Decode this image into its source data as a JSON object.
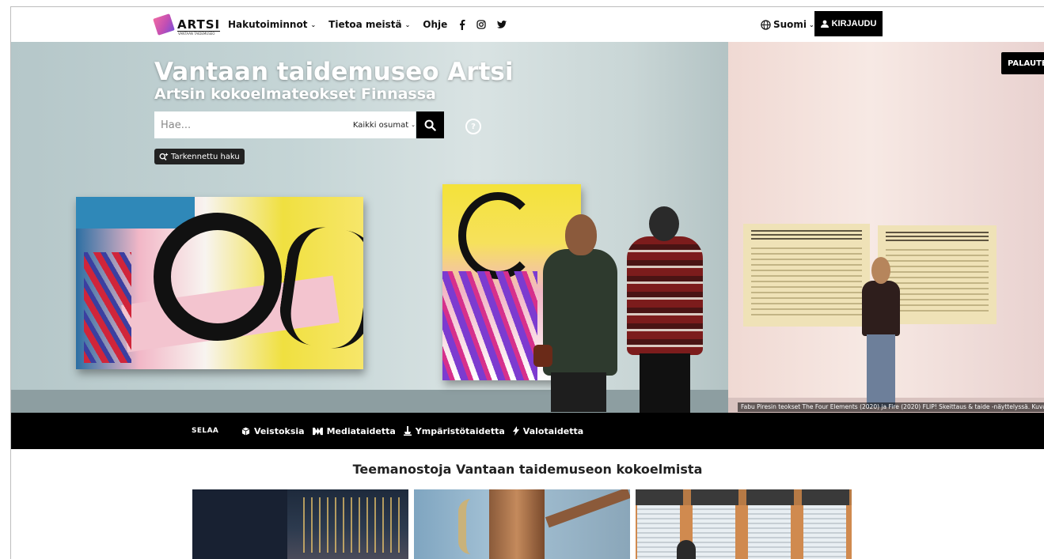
{
  "nav": {
    "logo_text": "ARTSI",
    "logo_subtext": "VANTAAN TAIDEMUSEO",
    "items": [
      {
        "label": "Hakutoiminnot",
        "dropdown": true
      },
      {
        "label": "Tietoa meistä",
        "dropdown": true
      },
      {
        "label": "Ohje",
        "dropdown": false
      }
    ],
    "social": [
      "facebook-icon",
      "instagram-icon",
      "twitter-icon"
    ],
    "language": "Suomi",
    "login_label": "KIRJAUDU"
  },
  "hero": {
    "title": "Vantaan taidemuseo Artsi",
    "subtitle": "Artsin kokoelmateokset Finnassa",
    "search": {
      "placeholder": "Hae...",
      "value": "",
      "type_selected": "Kaikki osumat"
    },
    "advanced_search_label": "Tarkennettu haku",
    "feedback_label": "PALAUTE",
    "image_caption": "Fabu Piresin teokset The Four Elements (2020) ja Fire (2020) FLIP! Skeittaus & taide -näyttelyssä. Kuva: A"
  },
  "browse": {
    "label": "SELAA",
    "items": [
      {
        "label": "Veistoksia",
        "icon": "cube-icon"
      },
      {
        "label": "Mediataidetta",
        "icon": "film-icon"
      },
      {
        "label": "Ympäristötaidetta",
        "icon": "tree-icon"
      },
      {
        "label": "Valotaidetta",
        "icon": "bolt-icon"
      }
    ]
  },
  "content": {
    "section_title": "Teemanostoja Vantaan taidemuseon kokoelmista"
  },
  "colors": {
    "primary": "#000000",
    "background": "#ffffff",
    "hero_text": "#ffffff"
  }
}
